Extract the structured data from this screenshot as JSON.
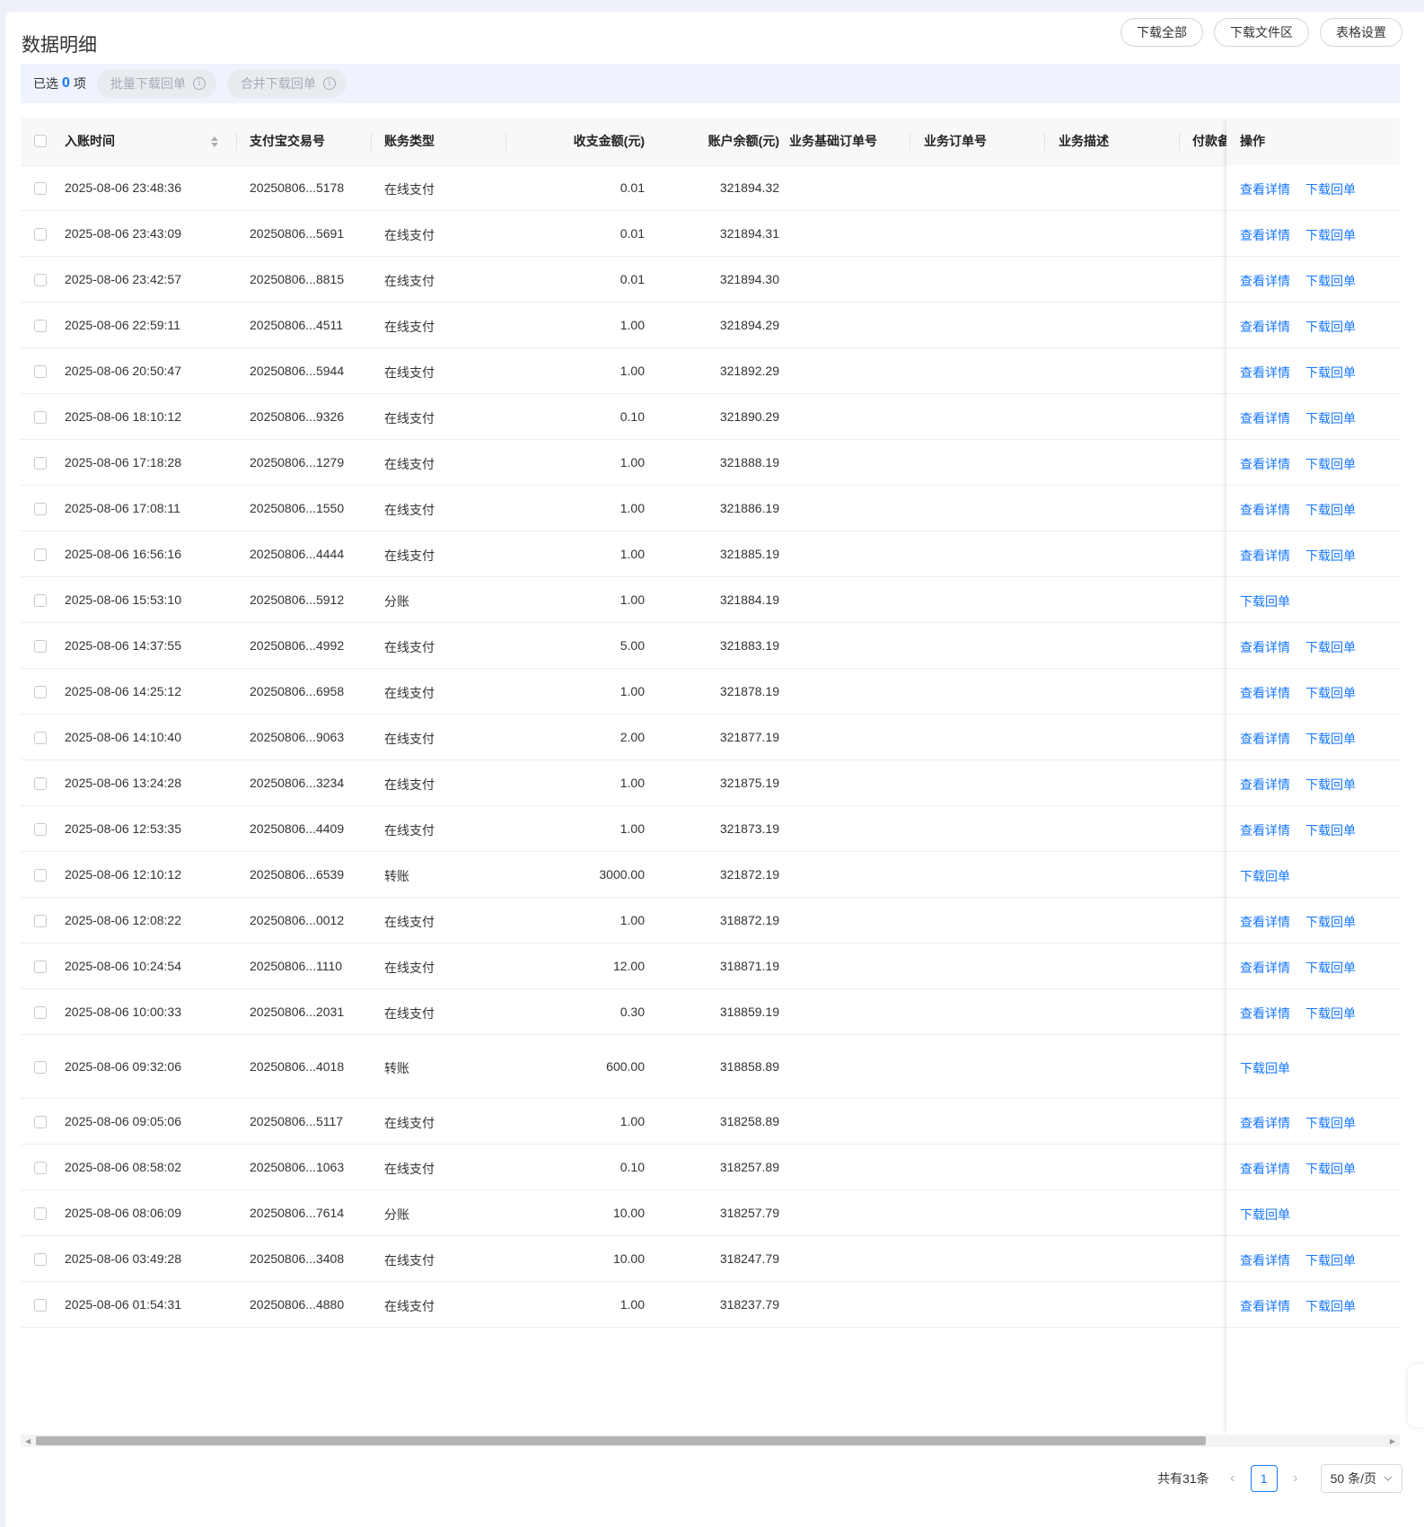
{
  "page": {
    "title": "数据明细",
    "top_buttons": [
      "下载全部",
      "下载文件区",
      "表格设置"
    ]
  },
  "selection": {
    "prefix": "已选",
    "count": "0",
    "suffix": "项",
    "batch_download": "批量下载回单",
    "merge_download": "合并下载回单"
  },
  "table": {
    "columns": [
      "入账时间",
      "支付宝交易号",
      "账务类型",
      "收支金额(元)",
      "账户余额(元)",
      "业务基础订单号",
      "业务订单号",
      "业务描述",
      "付款备",
      "操作"
    ],
    "op_view": "查看详情",
    "op_download": "下载回单",
    "rows": [
      {
        "time": "2025-08-06 23:48:36",
        "txn": "20250806...5178",
        "type": "在线支付",
        "amount": "0.01",
        "balance": "321894.32",
        "view": true
      },
      {
        "time": "2025-08-06 23:43:09",
        "txn": "20250806...5691",
        "type": "在线支付",
        "amount": "0.01",
        "balance": "321894.31",
        "view": true
      },
      {
        "time": "2025-08-06 23:42:57",
        "txn": "20250806...8815",
        "type": "在线支付",
        "amount": "0.01",
        "balance": "321894.30",
        "view": true
      },
      {
        "time": "2025-08-06 22:59:11",
        "txn": "20250806...4511",
        "type": "在线支付",
        "amount": "1.00",
        "balance": "321894.29",
        "view": true
      },
      {
        "time": "2025-08-06 20:50:47",
        "txn": "20250806...5944",
        "type": "在线支付",
        "amount": "1.00",
        "balance": "321892.29",
        "view": true
      },
      {
        "time": "2025-08-06 18:10:12",
        "txn": "20250806...9326",
        "type": "在线支付",
        "amount": "0.10",
        "balance": "321890.29",
        "view": true
      },
      {
        "time": "2025-08-06 17:18:28",
        "txn": "20250806...1279",
        "type": "在线支付",
        "amount": "1.00",
        "balance": "321888.19",
        "view": true
      },
      {
        "time": "2025-08-06 17:08:11",
        "txn": "20250806...1550",
        "type": "在线支付",
        "amount": "1.00",
        "balance": "321886.19",
        "view": true
      },
      {
        "time": "2025-08-06 16:56:16",
        "txn": "20250806...4444",
        "type": "在线支付",
        "amount": "1.00",
        "balance": "321885.19",
        "view": true
      },
      {
        "time": "2025-08-06 15:53:10",
        "txn": "20250806...5912",
        "type": "分账",
        "amount": "1.00",
        "balance": "321884.19",
        "view": false
      },
      {
        "time": "2025-08-06 14:37:55",
        "txn": "20250806...4992",
        "type": "在线支付",
        "amount": "5.00",
        "balance": "321883.19",
        "view": true
      },
      {
        "time": "2025-08-06 14:25:12",
        "txn": "20250806...6958",
        "type": "在线支付",
        "amount": "1.00",
        "balance": "321878.19",
        "view": true
      },
      {
        "time": "2025-08-06 14:10:40",
        "txn": "20250806...9063",
        "type": "在线支付",
        "amount": "2.00",
        "balance": "321877.19",
        "view": true
      },
      {
        "time": "2025-08-06 13:24:28",
        "txn": "20250806...3234",
        "type": "在线支付",
        "amount": "1.00",
        "balance": "321875.19",
        "view": true
      },
      {
        "time": "2025-08-06 12:53:35",
        "txn": "20250806...4409",
        "type": "在线支付",
        "amount": "1.00",
        "balance": "321873.19",
        "view": true
      },
      {
        "time": "2025-08-06 12:10:12",
        "txn": "20250806...6539",
        "type": "转账",
        "amount": "3000.00",
        "balance": "321872.19",
        "view": false
      },
      {
        "time": "2025-08-06 12:08:22",
        "txn": "20250806...0012",
        "type": "在线支付",
        "amount": "1.00",
        "balance": "318872.19",
        "view": true
      },
      {
        "time": "2025-08-06 10:24:54",
        "txn": "20250806...1110",
        "type": "在线支付",
        "amount": "12.00",
        "balance": "318871.19",
        "view": true
      },
      {
        "time": "2025-08-06 10:00:33",
        "txn": "20250806...2031",
        "type": "在线支付",
        "amount": "0.30",
        "balance": "318859.19",
        "view": true
      },
      {
        "time": "2025-08-06 09:32:06",
        "txn": "20250806...4018",
        "type": "转账",
        "amount": "600.00",
        "balance": "318858.89",
        "view": false
      },
      {
        "time": "2025-08-06 09:05:06",
        "txn": "20250806...5117",
        "type": "在线支付",
        "amount": "1.00",
        "balance": "318258.89",
        "view": true
      },
      {
        "time": "2025-08-06 08:58:02",
        "txn": "20250806...1063",
        "type": "在线支付",
        "amount": "0.10",
        "balance": "318257.89",
        "view": true
      },
      {
        "time": "2025-08-06 08:06:09",
        "txn": "20250806...7614",
        "type": "分账",
        "amount": "10.00",
        "balance": "318257.79",
        "view": false
      },
      {
        "time": "2025-08-06 03:49:28",
        "txn": "20250806...3408",
        "type": "在线支付",
        "amount": "10.00",
        "balance": "318247.79",
        "view": true
      },
      {
        "time": "2025-08-06 01:54:31",
        "txn": "20250806...4880",
        "type": "在线支付",
        "amount": "1.00",
        "balance": "318237.79",
        "view": true
      }
    ]
  },
  "pagination": {
    "total": "共有31条",
    "current_page": "1",
    "page_size": "50 条/页"
  },
  "colors": {
    "accent": "#1677ff",
    "selection_bar": "#eef3fd",
    "page_bg": "#eef1f7"
  }
}
